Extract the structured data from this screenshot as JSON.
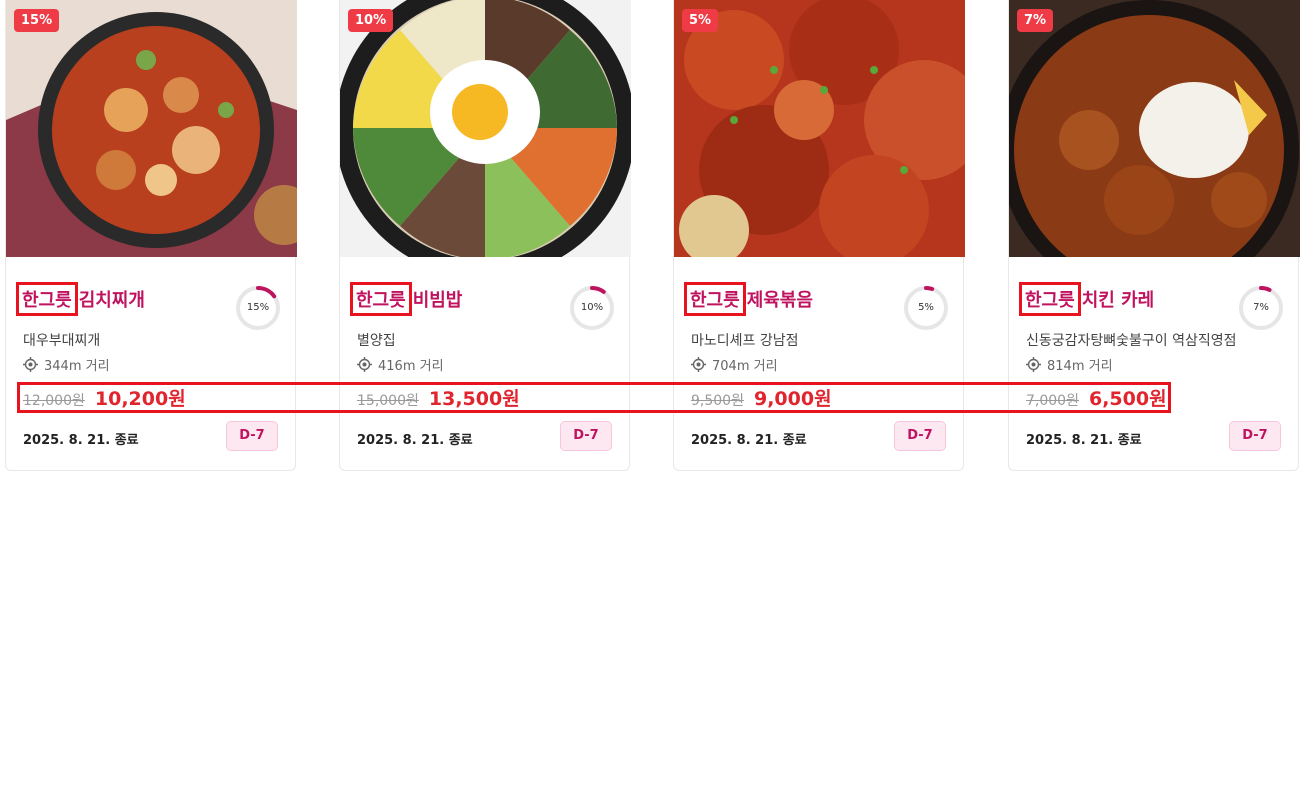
{
  "cards": [
    {
      "discount_badge": "15%",
      "tag": "한그릇",
      "menu": "김치찌개",
      "progress_label": "15%",
      "progress": 0.15,
      "store": "대우부대찌개",
      "distance": "344m 거리",
      "original_price": "12,000원",
      "sale_price": "10,200원",
      "end_date": "2025. 8. 21. 종료",
      "dday": "D-7"
    },
    {
      "discount_badge": "10%",
      "tag": "한그릇",
      "menu": "비빔밥",
      "progress_label": "10%",
      "progress": 0.1,
      "store": "별양집",
      "distance": "416m 거리",
      "original_price": "15,000원",
      "sale_price": "13,500원",
      "end_date": "2025. 8. 21. 종료",
      "dday": "D-7"
    },
    {
      "discount_badge": "5%",
      "tag": "한그릇",
      "menu": "제육볶음",
      "progress_label": "5%",
      "progress": 0.05,
      "store": "마노디셰프 강남점",
      "distance": "704m 거리",
      "original_price": "9,500원",
      "sale_price": "9,000원",
      "end_date": "2025. 8. 21. 종료",
      "dday": "D-7"
    },
    {
      "discount_badge": "7%",
      "tag": "한그릇",
      "menu": "치킨 카레",
      "progress_label": "7%",
      "progress": 0.07,
      "store": "신동궁감자탕뼈숯불구이 역삼직영점",
      "distance": "814m 거리",
      "original_price": "7,000원",
      "sale_price": "6,500원",
      "end_date": "2025. 8. 21. 종료",
      "dday": "D-7"
    }
  ],
  "colors": {
    "brand": "#c0135f",
    "sale": "#e0252f",
    "badge": "#ef3b46",
    "highlight": "#e8131f"
  },
  "icons": {
    "distance": "location-target-icon"
  }
}
